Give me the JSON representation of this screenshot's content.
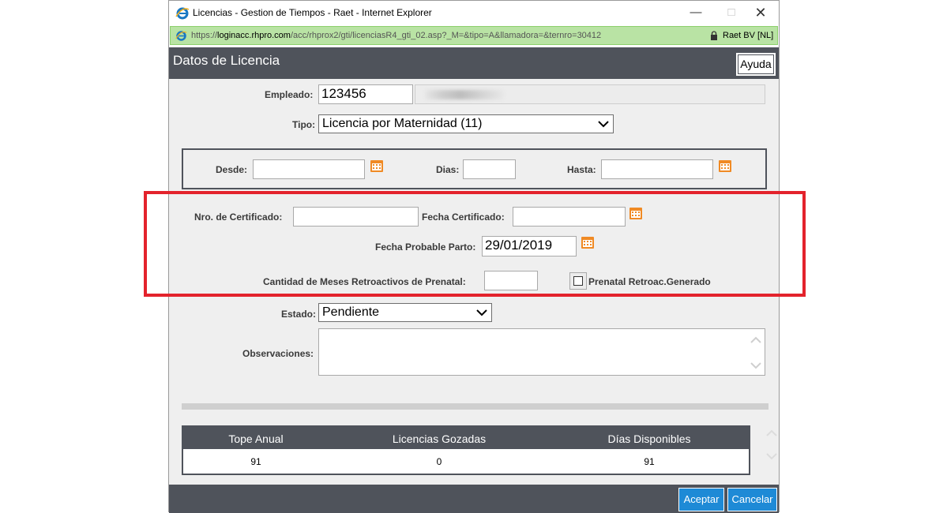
{
  "window": {
    "title": "Licencias - Gestion de Tiempos - Raet - Internet Explorer",
    "minimize_glyph": "—",
    "maximize_glyph": "□",
    "close_glyph": "✕"
  },
  "address_bar": {
    "url_prefix": "https://",
    "url_host": "loginacc.rhpro.com",
    "url_path": "/acc/rhprox2/gti/licenciasR4_gti_02.asp?_M=&tipo=A&llamadora=&ternro=30412",
    "cert_label": "Raet BV [NL]"
  },
  "header": {
    "title": "Datos de Licencia",
    "help_label": "Ayuda"
  },
  "form": {
    "empleado_label": "Empleado:",
    "empleado_value": "123456",
    "tipo_label": "Tipo:",
    "tipo_value": "Licencia por Maternidad (11)",
    "desde_label": "Desde:",
    "desde_value": "",
    "dias_label": "Dias:",
    "dias_value": "",
    "hasta_label": "Hasta:",
    "hasta_value": "",
    "nro_certificado_label": "Nro. de Certificado:",
    "nro_certificado_value": "",
    "fecha_certificado_label": "Fecha Certificado:",
    "fecha_certificado_value": "",
    "fecha_probable_parto_label": "Fecha Probable Parto:",
    "fecha_probable_parto_value": "29/01/2019",
    "meses_retro_label": "Cantidad de Meses Retroactivos de Prenatal:",
    "meses_retro_value": "",
    "prenatal_checkbox_label": "Prenatal Retroac.Generado",
    "prenatal_checked": false,
    "estado_label": "Estado:",
    "estado_value": "Pendiente",
    "observaciones_label": "Observaciones:",
    "observaciones_value": ""
  },
  "summary_table": {
    "headers": [
      "Tope Anual",
      "Licencias Gozadas",
      "Días Disponibles"
    ],
    "row": [
      "91",
      "0",
      "91"
    ]
  },
  "footer": {
    "accept_label": "Aceptar",
    "cancel_label": "Cancelar"
  },
  "colors": {
    "header_bg": "#4f535b",
    "address_bg": "#b9e3a4",
    "button_blue": "#1e8ad6",
    "highlight_red": "#e3232c",
    "calendar_orange": "#f08a24"
  },
  "icons": [
    "ie-logo-icon",
    "lock-icon",
    "calendar-icon",
    "chevron-down-icon",
    "scroll-up-icon",
    "scroll-down-icon"
  ]
}
